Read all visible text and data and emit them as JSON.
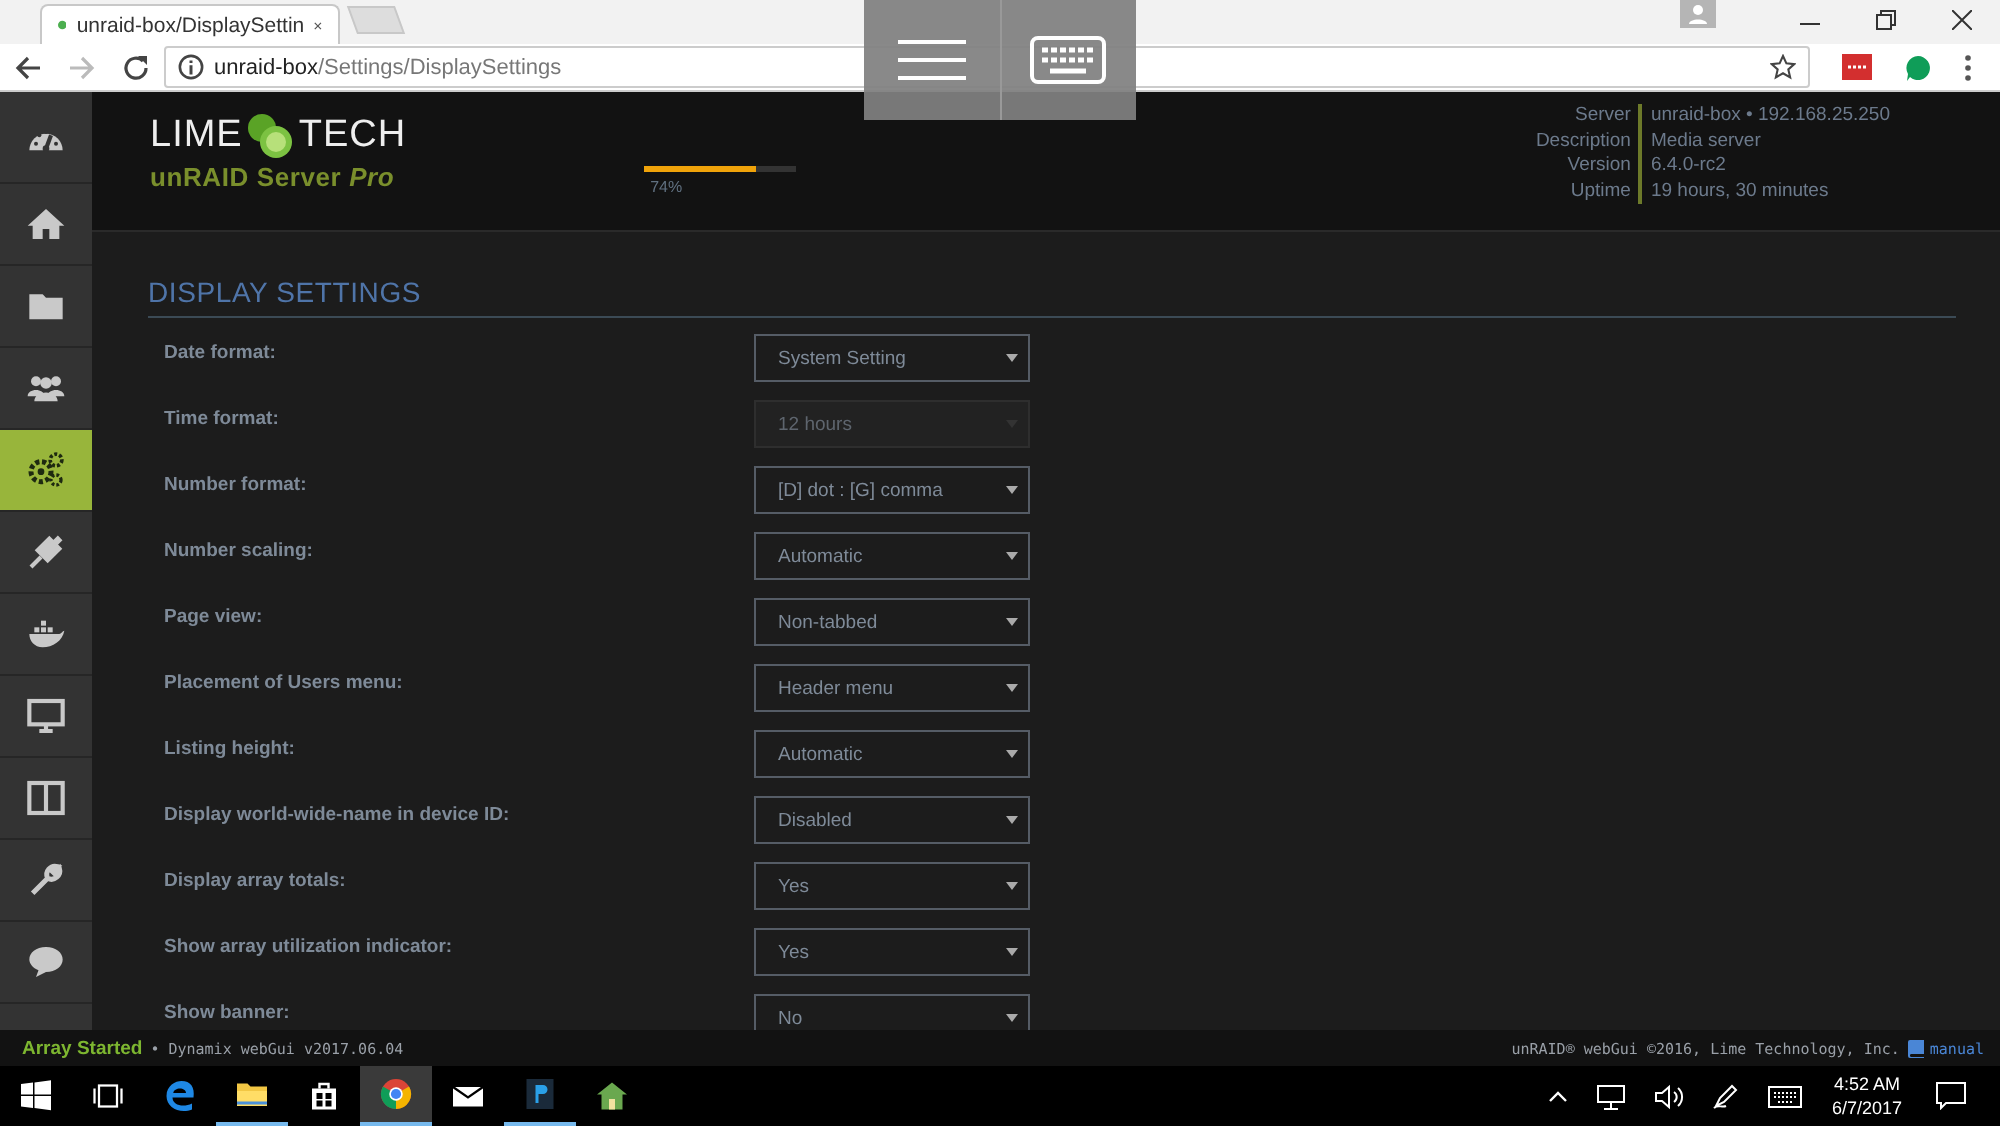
{
  "browser": {
    "tab": {
      "title": "unraid-box/DisplaySettin",
      "selected": true
    },
    "address": {
      "host": "unraid-box",
      "path": "/Settings/DisplaySettings"
    },
    "back_enabled": true,
    "forward_enabled": false
  },
  "sidebar": {
    "items": [
      {
        "selected": false
      },
      {
        "selected": false
      },
      {
        "selected": false
      },
      {
        "selected": false
      },
      {
        "selected": true
      },
      {
        "selected": false
      },
      {
        "selected": false
      },
      {
        "selected": false
      },
      {
        "selected": false
      },
      {
        "selected": false
      },
      {
        "selected": false
      }
    ]
  },
  "header": {
    "logo_left": "LIME",
    "logo_right": "TECH",
    "product": "unRAID Server",
    "edition": "Pro",
    "utilization": {
      "level": 0.74,
      "reading": "74%"
    },
    "info": [
      {
        "label": "Server",
        "value": "unraid-box • 192.168.25.250"
      },
      {
        "label": "Description",
        "value": "Media server"
      },
      {
        "label": "Version",
        "value": "6.4.0-rc2"
      },
      {
        "label": "Uptime",
        "value": "19 hours, 30 minutes"
      }
    ]
  },
  "settings": {
    "title": "DISPLAY SETTINGS",
    "rows": [
      {
        "label": "Date format:",
        "value": "System Setting",
        "disabled": false
      },
      {
        "label": "Time format:",
        "value": "12 hours",
        "disabled": true
      },
      {
        "label": "Number format:",
        "value": "[D] dot : [G] comma",
        "disabled": false
      },
      {
        "label": "Number scaling:",
        "value": "Automatic",
        "disabled": false
      },
      {
        "label": "Page view:",
        "value": "Non-tabbed",
        "disabled": false
      },
      {
        "label": "Placement of Users menu:",
        "value": "Header menu",
        "disabled": false
      },
      {
        "label": "Listing height:",
        "value": "Automatic",
        "disabled": false
      },
      {
        "label": "Display world-wide-name in device ID:",
        "value": "Disabled",
        "disabled": false
      },
      {
        "label": "Display array totals:",
        "value": "Yes",
        "disabled": false
      },
      {
        "label": "Show array utilization indicator:",
        "value": "Yes",
        "disabled": false
      },
      {
        "label": "Show banner:",
        "value": "No",
        "disabled": false
      }
    ]
  },
  "footer": {
    "status": "Array Started",
    "version": "• Dynamix webGui v2017.06.04",
    "copyright": "unRAID® webGui ©2016, Lime Technology, Inc.",
    "manual": "manual"
  },
  "taskbar": {
    "apps": [
      {
        "selected": false,
        "open": false
      },
      {
        "selected": false,
        "open": false
      },
      {
        "selected": false,
        "open": false
      },
      {
        "selected": false,
        "open": true
      },
      {
        "selected": false,
        "open": false
      },
      {
        "selected": true,
        "open": true
      },
      {
        "selected": false,
        "open": false
      },
      {
        "selected": false,
        "open": true
      },
      {
        "selected": false,
        "open": false
      }
    ],
    "time": "4:52 AM",
    "date": "6/7/2017"
  }
}
